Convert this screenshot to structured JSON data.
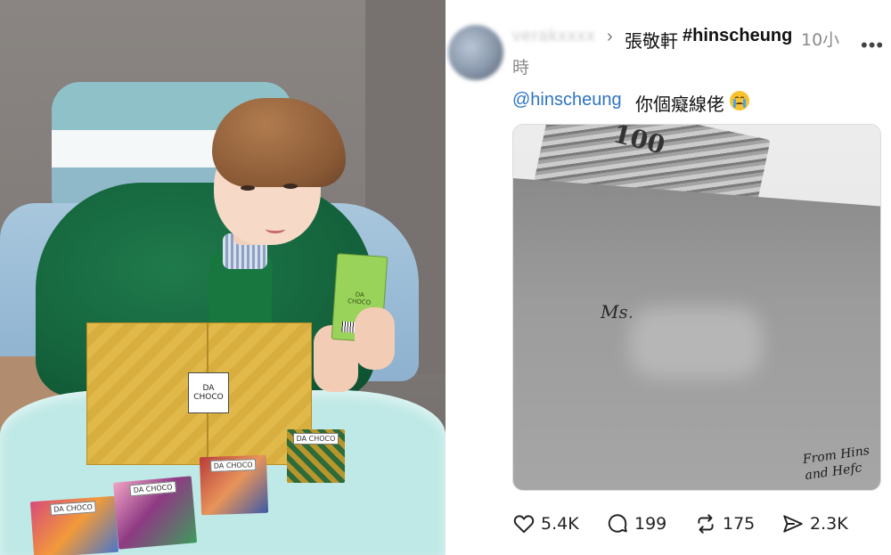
{
  "post": {
    "username": "verakxxxx",
    "reply_separator": "›",
    "reply_to_name": "張敬軒",
    "hashtag": "#hinscheung",
    "time_part1": "10小",
    "time_part2": "時",
    "more_label": "•••",
    "mention": "@hinscheung",
    "text": "你個癡線佬",
    "emoji": "loudly-crying-face",
    "media_note_text": "100",
    "media_addressee_prefix": "Ms.",
    "media_signature_line1": "From Hins",
    "media_signature_line2": "and Hefc"
  },
  "actions": {
    "likes": "5.4K",
    "replies": "199",
    "reposts": "175",
    "shares": "2.3K"
  },
  "photo": {
    "gift_box_label_line1": "DA",
    "gift_box_label_line2": "CHOCO",
    "bar_label_line1": "DA",
    "bar_label_line2": "CHOCO",
    "choc1_label": "DA CHOCO",
    "choc2_label": "DA CHOCO",
    "choc3_label": "DA CHOCO",
    "choc4_label": "DA CHOCO"
  },
  "colors": {
    "link": "#2f74c0",
    "text": "#111111",
    "muted": "#8a8a8a",
    "jacket_green": "#13603a",
    "gift_box_gold": "#e0b94a"
  }
}
